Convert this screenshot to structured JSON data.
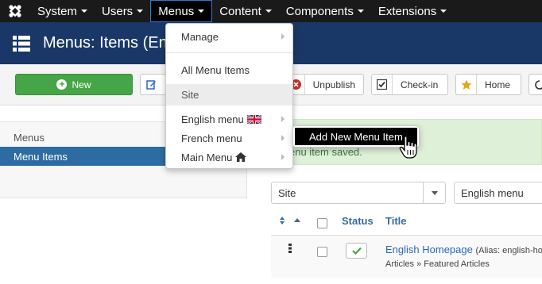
{
  "navbar": {
    "items": [
      {
        "label": "System"
      },
      {
        "label": "Users"
      },
      {
        "label": "Menus"
      },
      {
        "label": "Content"
      },
      {
        "label": "Components"
      },
      {
        "label": "Extensions"
      }
    ]
  },
  "header": {
    "title": "Menus: Items (En"
  },
  "toolbar": {
    "new_label": "New",
    "unpublish_label": "Unpublish",
    "checkin_label": "Check-in",
    "home_label": "Home"
  },
  "sidebar": {
    "items": [
      {
        "label": "Menus"
      },
      {
        "label": "Menu Items"
      }
    ]
  },
  "menus_dropdown": {
    "items": [
      {
        "label": "Manage"
      },
      {
        "label": "All Menu Items"
      },
      {
        "label": "Site"
      },
      {
        "label": "English menu"
      },
      {
        "label": "French menu"
      },
      {
        "label": "Main Menu"
      }
    ],
    "submenu_item": "Add New Menu Item"
  },
  "message": {
    "text": "enu item saved."
  },
  "filters": {
    "client": "Site",
    "menu": "English menu"
  },
  "table": {
    "headers": {
      "status": "Status",
      "title": "Title"
    },
    "rows": [
      {
        "title": "English Homepage",
        "alias": "(Alias: english-ho",
        "subtitle": "Articles » Featured Articles"
      }
    ]
  },
  "colors": {
    "navbar": "#1a1a1a",
    "header": "#1a3867",
    "new_button": "#46a546",
    "active_sidebar": "#2d6ca2",
    "link": "#2a69b8",
    "alert_bg": "#dff0d8"
  }
}
